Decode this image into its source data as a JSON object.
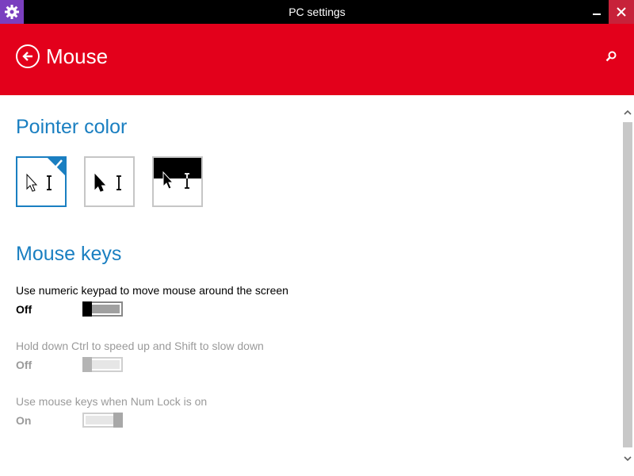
{
  "window": {
    "title": "PC settings",
    "icon": "gear-icon",
    "controls": [
      "minimize-icon",
      "close-icon"
    ]
  },
  "header": {
    "title": "Mouse",
    "back_icon": "back-arrow-icon",
    "search_icon": "search-icon"
  },
  "pointer_color": {
    "heading": "Pointer color",
    "options": [
      {
        "name": "white-pointer",
        "selected": true
      },
      {
        "name": "black-pointer",
        "selected": false
      },
      {
        "name": "inverted-pointer",
        "selected": false
      }
    ]
  },
  "mouse_keys": {
    "heading": "Mouse keys",
    "settings": [
      {
        "label": "Use numeric keypad to move mouse around the screen",
        "state": "Off",
        "enabled": true,
        "on": false
      },
      {
        "label": "Hold down Ctrl to speed up and Shift to slow down",
        "state": "Off",
        "enabled": false,
        "on": false
      },
      {
        "label": "Use mouse keys when Num Lock is on",
        "state": "On",
        "enabled": false,
        "on": true
      }
    ]
  },
  "colors": {
    "accent": "#1a7fc1",
    "header": "#e3001b",
    "titlebar": "#000000",
    "close_button": "#c7223a",
    "app_icon": "#7a3fbf",
    "disabled_text": "#9a9a9a"
  }
}
